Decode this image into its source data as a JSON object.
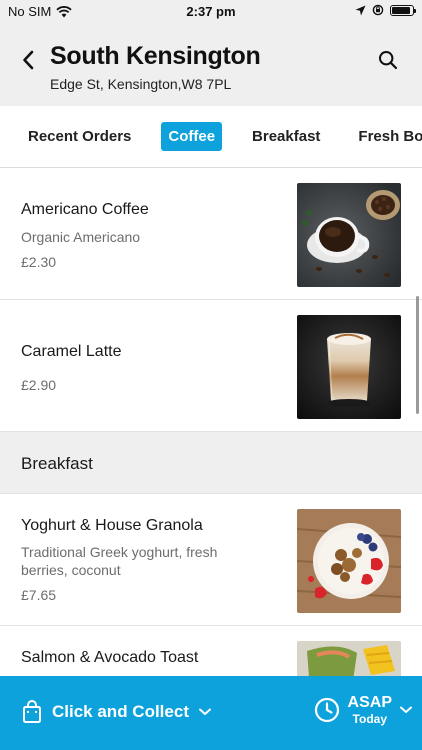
{
  "status_bar": {
    "carrier": "No SIM",
    "time": "2:37 pm",
    "battery_level": 0.9
  },
  "header": {
    "store_name": "South Kensington",
    "address": "Edge St, Kensington,W8 7PL",
    "back_icon": "chevron-left-icon",
    "search_icon": "search-icon"
  },
  "tabs": [
    {
      "label": "Recent Orders",
      "active": false
    },
    {
      "label": "Coffee",
      "active": true
    },
    {
      "label": "Breakfast",
      "active": false
    },
    {
      "label": "Fresh Bowls",
      "active": false
    }
  ],
  "coffee_items": [
    {
      "name": "Americano Coffee",
      "description": "Organic Americano",
      "price": "£2.30",
      "image": "americano-coffee-photo"
    },
    {
      "name": "Caramel Latte",
      "description": "",
      "price": "£2.90",
      "image": "caramel-latte-photo"
    }
  ],
  "breakfast_section": {
    "title": "Breakfast",
    "items": [
      {
        "name": "Yoghurt & House Granola",
        "description": "Traditional Greek yoghurt, fresh berries, coconut",
        "price": "£7.65",
        "image": "yoghurt-granola-photo"
      },
      {
        "name": "Salmon & Avocado Toast",
        "description": "",
        "price": "",
        "image": "salmon-avocado-toast-photo"
      }
    ]
  },
  "bottom_bar": {
    "collect_label": "Click and Collect",
    "time_main": "ASAP",
    "time_sub": "Today"
  },
  "colors": {
    "accent": "#0da2dc",
    "header_bg": "#efefef"
  }
}
